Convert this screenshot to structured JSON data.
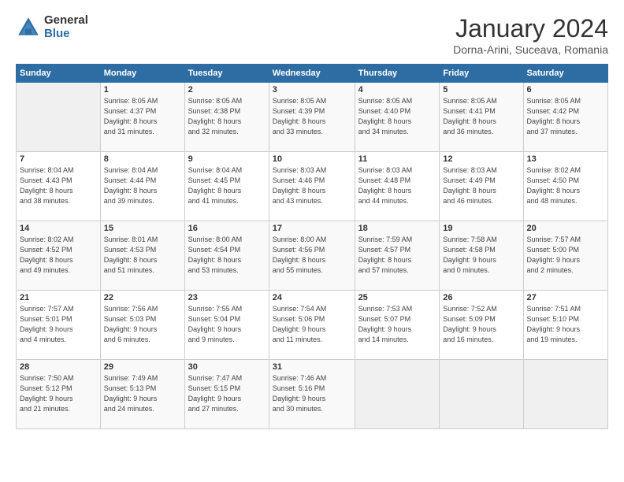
{
  "logo": {
    "general": "General",
    "blue": "Blue"
  },
  "header": {
    "title": "January 2024",
    "location": "Dorna-Arini, Suceava, Romania"
  },
  "weekdays": [
    "Sunday",
    "Monday",
    "Tuesday",
    "Wednesday",
    "Thursday",
    "Friday",
    "Saturday"
  ],
  "weeks": [
    [
      {
        "day": "",
        "info": ""
      },
      {
        "day": "1",
        "info": "Sunrise: 8:05 AM\nSunset: 4:37 PM\nDaylight: 8 hours\nand 31 minutes."
      },
      {
        "day": "2",
        "info": "Sunrise: 8:05 AM\nSunset: 4:38 PM\nDaylight: 8 hours\nand 32 minutes."
      },
      {
        "day": "3",
        "info": "Sunrise: 8:05 AM\nSunset: 4:39 PM\nDaylight: 8 hours\nand 33 minutes."
      },
      {
        "day": "4",
        "info": "Sunrise: 8:05 AM\nSunset: 4:40 PM\nDaylight: 8 hours\nand 34 minutes."
      },
      {
        "day": "5",
        "info": "Sunrise: 8:05 AM\nSunset: 4:41 PM\nDaylight: 8 hours\nand 36 minutes."
      },
      {
        "day": "6",
        "info": "Sunrise: 8:05 AM\nSunset: 4:42 PM\nDaylight: 8 hours\nand 37 minutes."
      }
    ],
    [
      {
        "day": "7",
        "info": "Sunrise: 8:04 AM\nSunset: 4:43 PM\nDaylight: 8 hours\nand 38 minutes."
      },
      {
        "day": "8",
        "info": "Sunrise: 8:04 AM\nSunset: 4:44 PM\nDaylight: 8 hours\nand 39 minutes."
      },
      {
        "day": "9",
        "info": "Sunrise: 8:04 AM\nSunset: 4:45 PM\nDaylight: 8 hours\nand 41 minutes."
      },
      {
        "day": "10",
        "info": "Sunrise: 8:03 AM\nSunset: 4:46 PM\nDaylight: 8 hours\nand 43 minutes."
      },
      {
        "day": "11",
        "info": "Sunrise: 8:03 AM\nSunset: 4:48 PM\nDaylight: 8 hours\nand 44 minutes."
      },
      {
        "day": "12",
        "info": "Sunrise: 8:03 AM\nSunset: 4:49 PM\nDaylight: 8 hours\nand 46 minutes."
      },
      {
        "day": "13",
        "info": "Sunrise: 8:02 AM\nSunset: 4:50 PM\nDaylight: 8 hours\nand 48 minutes."
      }
    ],
    [
      {
        "day": "14",
        "info": "Sunrise: 8:02 AM\nSunset: 4:52 PM\nDaylight: 8 hours\nand 49 minutes."
      },
      {
        "day": "15",
        "info": "Sunrise: 8:01 AM\nSunset: 4:53 PM\nDaylight: 8 hours\nand 51 minutes."
      },
      {
        "day": "16",
        "info": "Sunrise: 8:00 AM\nSunset: 4:54 PM\nDaylight: 8 hours\nand 53 minutes."
      },
      {
        "day": "17",
        "info": "Sunrise: 8:00 AM\nSunset: 4:56 PM\nDaylight: 8 hours\nand 55 minutes."
      },
      {
        "day": "18",
        "info": "Sunrise: 7:59 AM\nSunset: 4:57 PM\nDaylight: 8 hours\nand 57 minutes."
      },
      {
        "day": "19",
        "info": "Sunrise: 7:58 AM\nSunset: 4:58 PM\nDaylight: 9 hours\nand 0 minutes."
      },
      {
        "day": "20",
        "info": "Sunrise: 7:57 AM\nSunset: 5:00 PM\nDaylight: 9 hours\nand 2 minutes."
      }
    ],
    [
      {
        "day": "21",
        "info": "Sunrise: 7:57 AM\nSunset: 5:01 PM\nDaylight: 9 hours\nand 4 minutes."
      },
      {
        "day": "22",
        "info": "Sunrise: 7:56 AM\nSunset: 5:03 PM\nDaylight: 9 hours\nand 6 minutes."
      },
      {
        "day": "23",
        "info": "Sunrise: 7:55 AM\nSunset: 5:04 PM\nDaylight: 9 hours\nand 9 minutes."
      },
      {
        "day": "24",
        "info": "Sunrise: 7:54 AM\nSunset: 5:06 PM\nDaylight: 9 hours\nand 11 minutes."
      },
      {
        "day": "25",
        "info": "Sunrise: 7:53 AM\nSunset: 5:07 PM\nDaylight: 9 hours\nand 14 minutes."
      },
      {
        "day": "26",
        "info": "Sunrise: 7:52 AM\nSunset: 5:09 PM\nDaylight: 9 hours\nand 16 minutes."
      },
      {
        "day": "27",
        "info": "Sunrise: 7:51 AM\nSunset: 5:10 PM\nDaylight: 9 hours\nand 19 minutes."
      }
    ],
    [
      {
        "day": "28",
        "info": "Sunrise: 7:50 AM\nSunset: 5:12 PM\nDaylight: 9 hours\nand 21 minutes."
      },
      {
        "day": "29",
        "info": "Sunrise: 7:49 AM\nSunset: 5:13 PM\nDaylight: 9 hours\nand 24 minutes."
      },
      {
        "day": "30",
        "info": "Sunrise: 7:47 AM\nSunset: 5:15 PM\nDaylight: 9 hours\nand 27 minutes."
      },
      {
        "day": "31",
        "info": "Sunrise: 7:46 AM\nSunset: 5:16 PM\nDaylight: 9 hours\nand 30 minutes."
      },
      {
        "day": "",
        "info": ""
      },
      {
        "day": "",
        "info": ""
      },
      {
        "day": "",
        "info": ""
      }
    ]
  ]
}
